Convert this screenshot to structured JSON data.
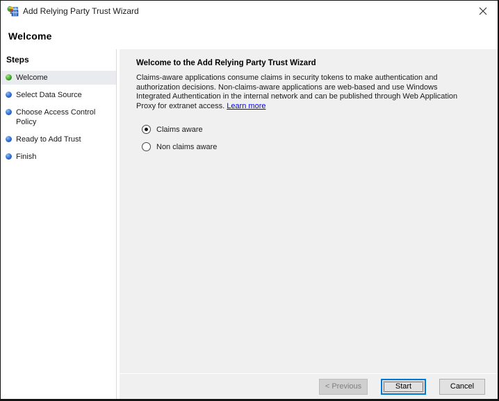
{
  "window": {
    "title": "Add Relying Party Trust Wizard",
    "page_title": "Welcome"
  },
  "sidebar": {
    "header": "Steps",
    "items": [
      {
        "label": "Welcome",
        "state": "current"
      },
      {
        "label": "Select Data Source",
        "state": "upcoming"
      },
      {
        "label": "Choose Access Control Policy",
        "state": "upcoming"
      },
      {
        "label": "Ready to Add Trust",
        "state": "upcoming"
      },
      {
        "label": "Finish",
        "state": "upcoming"
      }
    ]
  },
  "content": {
    "heading": "Welcome to the Add Relying Party Trust Wizard",
    "body_lines": [
      "Claims-aware applications consume claims in security tokens to make authentication and",
      "authorization decisions. Non-claims-aware applications are web-based and use Windows",
      "Integrated Authentication in the internal network and can be published through Web Application",
      "Proxy for extranet access."
    ],
    "learn_more_label": "Learn more",
    "radio_options": [
      {
        "label": "Claims aware",
        "selected": true
      },
      {
        "label": "Non claims aware",
        "selected": false
      }
    ]
  },
  "footer": {
    "previous_label": "< Previous",
    "start_label": "Start",
    "cancel_label": "Cancel"
  },
  "colors": {
    "accent_blue": "#0078d7",
    "link_blue": "#0000ee",
    "current_step_bullet": "#3fa52c",
    "upcoming_step_bullet": "#2f6bd0",
    "content_bg": "#f0f0f0",
    "active_step_bg": "#e9ebee",
    "window_border": "#141414"
  }
}
